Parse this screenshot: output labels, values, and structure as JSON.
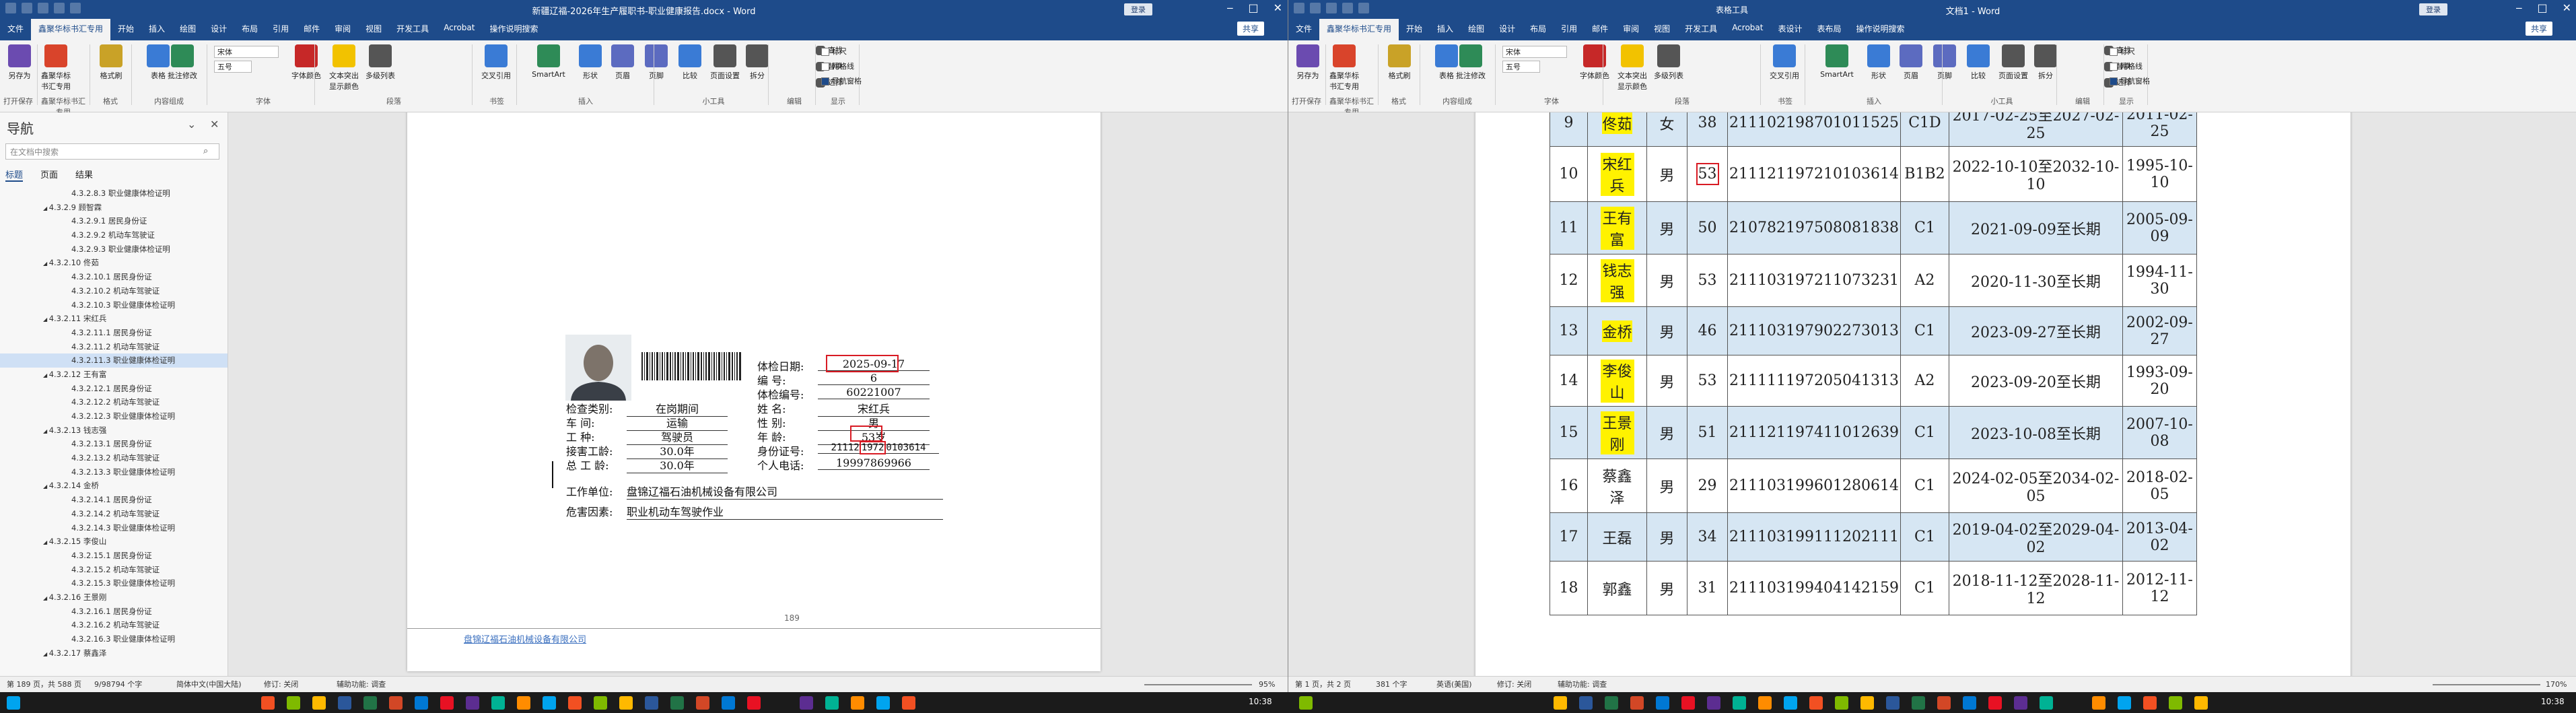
{
  "left": {
    "title": "新疆辽福-2026年生产履职书-职业健康报告.docx - Word",
    "login": "登录",
    "tabs": [
      "文件",
      "鑫聚华标书汇专用",
      "开始",
      "插入",
      "绘图",
      "设计",
      "布局",
      "引用",
      "邮件",
      "审阅",
      "视图",
      "开发工具",
      "Acrobat",
      "操作说明搜索"
    ],
    "active_tab": "鑫聚华标书汇专用",
    "share": "共享",
    "ribbon": {
      "buttons": [
        "另存为",
        "鑫聚华标书汇专用",
        "格式刷",
        "表格",
        "批注修改",
        "字体颜色",
        "文本突出显示颜色",
        "多级列表",
        "交叉引用",
        "SmartArt",
        "形状",
        "页眉",
        "页脚",
        "比较",
        "页面设置",
        "拆分",
        "查找",
        "替换",
        "选择"
      ],
      "font_name": "宋体",
      "font_size": "五号",
      "checks": [
        "标尺",
        "网格线",
        "导航窗格"
      ],
      "groups": [
        "打开保存",
        "鑫聚华标书汇专用",
        "格式",
        "内容组成",
        "字体",
        "段落",
        "书签",
        "插入",
        "小工具",
        "编辑",
        "显示"
      ]
    },
    "nav": {
      "title": "导航",
      "search_placeholder": "在文档中搜索",
      "tabs": [
        "标题",
        "页面",
        "结果"
      ],
      "active_tab": "标题",
      "items": [
        {
          "text": "4.3.2.8.3 职业健康体检证明",
          "level": 3
        },
        {
          "text": "4.3.2.9 顾智霖",
          "level": 2
        },
        {
          "text": "4.3.2.9.1 居民身份证",
          "level": 3
        },
        {
          "text": "4.3.2.9.2 机动车驾驶证",
          "level": 3
        },
        {
          "text": "4.3.2.9.3 职业健康体检证明",
          "level": 3
        },
        {
          "text": "4.3.2.10 佟茹",
          "level": 2
        },
        {
          "text": "4.3.2.10.1 居民身份证",
          "level": 3
        },
        {
          "text": "4.3.2.10.2 机动车驾驶证",
          "level": 3
        },
        {
          "text": "4.3.2.10.3 职业健康体检证明",
          "level": 3
        },
        {
          "text": "4.3.2.11 宋红兵",
          "level": 2
        },
        {
          "text": "4.3.2.11.1 居民身份证",
          "level": 3
        },
        {
          "text": "4.3.2.11.2 机动车驾驶证",
          "level": 3
        },
        {
          "text": "4.3.2.11.3 职业健康体检证明",
          "level": 3,
          "selected": true
        },
        {
          "text": "4.3.2.12 王有富",
          "level": 2
        },
        {
          "text": "4.3.2.12.1 居民身份证",
          "level": 3
        },
        {
          "text": "4.3.2.12.2 机动车驾驶证",
          "level": 3
        },
        {
          "text": "4.3.2.12.3 职业健康体检证明",
          "level": 3
        },
        {
          "text": "4.3.2.13 钱志强",
          "level": 2
        },
        {
          "text": "4.3.2.13.1 居民身份证",
          "level": 3
        },
        {
          "text": "4.3.2.13.2 机动车驾驶证",
          "level": 3
        },
        {
          "text": "4.3.2.13.3 职业健康体检证明",
          "level": 3
        },
        {
          "text": "4.3.2.14 金桥",
          "level": 2
        },
        {
          "text": "4.3.2.14.1 居民身份证",
          "level": 3
        },
        {
          "text": "4.3.2.14.2 机动车驾驶证",
          "level": 3
        },
        {
          "text": "4.3.2.14.3 职业健康体检证明",
          "level": 3
        },
        {
          "text": "4.3.2.15 李俊山",
          "level": 2
        },
        {
          "text": "4.3.2.15.1 居民身份证",
          "level": 3
        },
        {
          "text": "4.3.2.15.2 机动车驾驶证",
          "level": 3
        },
        {
          "text": "4.3.2.15.3 职业健康体检证明",
          "level": 3
        },
        {
          "text": "4.3.2.16 王景刚",
          "level": 2
        },
        {
          "text": "4.3.2.16.1 居民身份证",
          "level": 3
        },
        {
          "text": "4.3.2.16.2 机动车驾驶证",
          "level": 3
        },
        {
          "text": "4.3.2.16.3 职业健康体检证明",
          "level": 3
        },
        {
          "text": "4.3.2.17 蔡鑫泽",
          "level": 2
        }
      ]
    },
    "form": {
      "exam_date_label": "体检日期:",
      "exam_date_value": "2025-09-17",
      "number_label": "编    号:",
      "number_value": "6",
      "exam_no_label": "体检编号:",
      "exam_no_value": "60221007",
      "name_label": "姓    名:",
      "name_value": "宋红兵",
      "gender_label": "性    别:",
      "gender_value": "男",
      "age_label": "年    龄:",
      "age_value": "53岁",
      "id_label": "身份证号:",
      "id_value_pre": "21112",
      "id_value_mark": "1972",
      "id_value_post": "0103614",
      "phone_label": "个人电话:",
      "phone_value": "19997869966",
      "category_label": "检查类别:",
      "category_value": "在岗期间",
      "workshop_label": "车    间:",
      "workshop_value": "运输",
      "job_label": "工    种:",
      "job_value": "驾驶员",
      "exposure_years_label": "接害工龄:",
      "exposure_years_value": "30.0年",
      "total_years_label": "总 工 龄:",
      "total_years_value": "30.0年",
      "employer_label": "工作单位:",
      "employer_value": "盘锦辽福石油机械设备有限公司",
      "hazard_label": "危害因素:",
      "hazard_value": "职业机动车驾驶作业",
      "footer_company": "盘锦辽福石油机械设备有限公司",
      "page_number": "189"
    },
    "status": {
      "page": "第 189 页，共 588 页",
      "words": "9/98794 个字",
      "lang": "简体中文(中国大陆)",
      "track": "修订: 关闭",
      "accessibility": "辅助功能: 调查",
      "zoom": "95%"
    }
  },
  "right": {
    "title": "文档1 - Word",
    "table_tools": "表格工具",
    "login": "登录",
    "tabs": [
      "文件",
      "鑫聚华标书汇专用",
      "开始",
      "插入",
      "绘图",
      "设计",
      "布局",
      "引用",
      "邮件",
      "审阅",
      "视图",
      "开发工具",
      "Acrobat",
      "表设计",
      "表布局",
      "操作说明搜索"
    ],
    "active_tab": "鑫聚华标书汇专用",
    "share": "共享",
    "ribbon": {
      "buttons": [
        "另存为",
        "鑫聚华标书汇专用",
        "格式刷",
        "表格",
        "批注修改",
        "字体颜色",
        "文本突出显示颜色",
        "多级列表",
        "交叉引用",
        "SmartArt",
        "形状",
        "页眉",
        "页脚",
        "比较",
        "页面设置",
        "拆分",
        "查找",
        "替换",
        "选择"
      ],
      "font_name": "宋体",
      "font_size": "五号",
      "checks": [
        "标尺",
        "网格线",
        "导航窗格"
      ],
      "groups": [
        "打开保存",
        "鑫聚华标书汇专用",
        "格式",
        "内容组成",
        "字体",
        "段落",
        "书签",
        "插入",
        "小工具",
        "编辑",
        "显示"
      ]
    },
    "table": {
      "rows": [
        {
          "no": "9",
          "name": "佟茹",
          "hl": true,
          "gender": "女",
          "age": "38",
          "id": "211102198701011525",
          "cls": "C1D",
          "validity": "2017-02-25至2027-02-25",
          "first": "2011-02-25"
        },
        {
          "no": "10",
          "name": "宋红兵",
          "hl": true,
          "gender": "男",
          "age": "53",
          "age_box": true,
          "id": "211121197210103614",
          "cls": "B1B2",
          "validity": "2022-10-10至2032-10-10",
          "first": "1995-10-10"
        },
        {
          "no": "11",
          "name": "王有富",
          "hl": true,
          "gender": "男",
          "age": "50",
          "id": "210782197508081838",
          "cls": "C1",
          "validity": "2021-09-09至长期",
          "first": "2005-09-09"
        },
        {
          "no": "12",
          "name": "钱志强",
          "hl": true,
          "gender": "男",
          "age": "53",
          "id": "211103197211073231",
          "cls": "A2",
          "validity": "2020-11-30至长期",
          "first": "1994-11-30"
        },
        {
          "no": "13",
          "name": "金桥",
          "hl": true,
          "gender": "男",
          "age": "46",
          "id": "211103197902273013",
          "cls": "C1",
          "validity": "2023-09-27至长期",
          "first": "2002-09-27"
        },
        {
          "no": "14",
          "name": "李俊山",
          "hl": true,
          "gender": "男",
          "age": "53",
          "id": "211111197205041313",
          "cls": "A2",
          "validity": "2023-09-20至长期",
          "first": "1993-09-20"
        },
        {
          "no": "15",
          "name": "王景刚",
          "hl": true,
          "gender": "男",
          "age": "51",
          "id": "211121197411012639",
          "cls": "C1",
          "validity": "2023-10-08至长期",
          "first": "2007-10-08"
        },
        {
          "no": "16",
          "name": "蔡鑫泽",
          "hl": false,
          "gender": "男",
          "age": "29",
          "id": "211103199601280614",
          "cls": "C1",
          "validity": "2024-02-05至2034-02-05",
          "first": "2018-02-05"
        },
        {
          "no": "17",
          "name": "王磊",
          "hl": false,
          "gender": "男",
          "age": "34",
          "id": "211103199111202111",
          "cls": "C1",
          "validity": "2019-04-02至2029-04-02",
          "first": "2013-04-02"
        },
        {
          "no": "18",
          "name": "郭鑫",
          "hl": false,
          "gender": "男",
          "age": "31",
          "id": "211103199404142159",
          "cls": "C1",
          "validity": "2018-11-12至2028-11-12",
          "first": "2012-11-12"
        }
      ]
    },
    "status": {
      "page": "第 1 页，共 2 页",
      "words": "381 个字",
      "lang": "英语(美国)",
      "track": "修订: 关闭",
      "accessibility": "辅助功能: 调查",
      "zoom": "170%"
    }
  },
  "taskbar": {
    "time_left": "10:38",
    "time_right": "10:38"
  },
  "colors": {
    "title_blue": "#1e4b8a",
    "highlight_yellow": "#fff200",
    "mark_red": "#d81b24",
    "row_alt": "#d6e6f3"
  }
}
